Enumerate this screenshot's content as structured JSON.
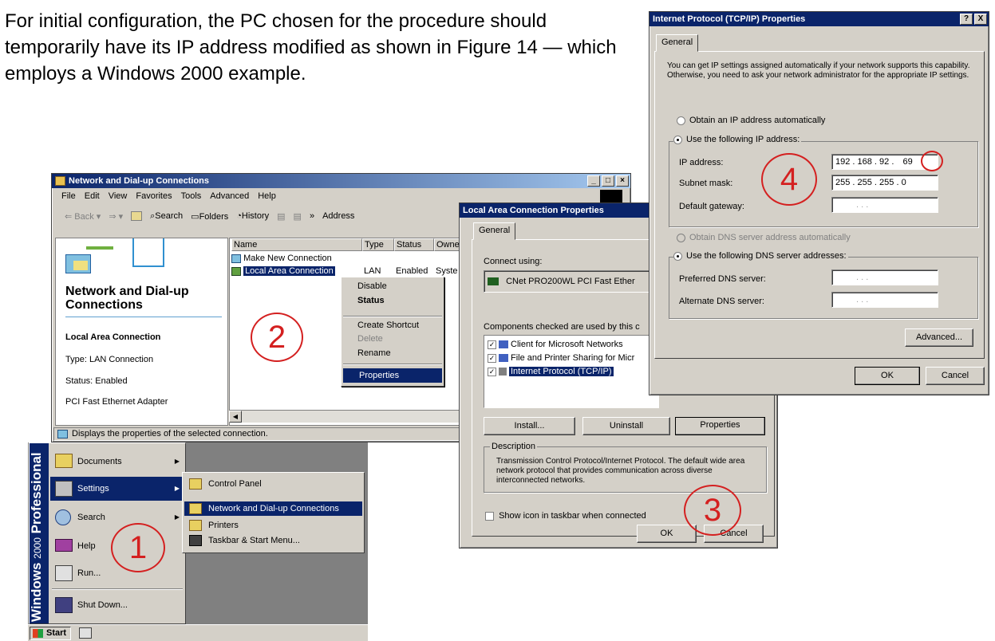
{
  "intro_text": "For initial configuration, the PC chosen for the procedure should temporarily have its IP address modified as shown in Figure 14 — which employs a Windows 2000 example.",
  "ndc": {
    "title": "Network and Dial-up Connections",
    "menu": [
      "File",
      "Edit",
      "View",
      "Favorites",
      "Tools",
      "Advanced",
      "Help"
    ],
    "toolbar": {
      "back": "Back",
      "search": "Search",
      "folders": "Folders",
      "history": "History",
      "address": "Address"
    },
    "heading": "Network and Dial-up Connections",
    "sidebar": {
      "name": "Local Area Connection",
      "type": "Type: LAN Connection",
      "status": "Status: Enabled",
      "adapter": "PCI Fast Ethernet Adapter"
    },
    "columns": [
      "Name",
      "Type",
      "Status",
      "Owne"
    ],
    "rows": [
      {
        "name": "Make New Connection",
        "type": "",
        "status": "",
        "owner": ""
      },
      {
        "name": "Local Area Connection",
        "type": "LAN",
        "status": "Enabled",
        "owner": "Syste"
      }
    ],
    "context_menu": [
      "Disable",
      "Status",
      "Create Shortcut",
      "Delete",
      "Rename",
      "Properties"
    ],
    "statusbar": "Displays the properties of the selected connection."
  },
  "start_menu": {
    "banner_bold": "Windows",
    "banner_num": "2000",
    "banner_ed": "Professional",
    "items": [
      "Documents",
      "Settings",
      "Search",
      "Help",
      "Run...",
      "Shut Down..."
    ],
    "submenu": [
      "Control Panel",
      "Network and Dial-up Connections",
      "Printers",
      "Taskbar & Start Menu..."
    ],
    "start_label": "Start"
  },
  "lac": {
    "title": "Local Area Connection Properties",
    "tab": "General",
    "connect_using": "Connect using:",
    "adapter": "CNet PRO200WL PCI Fast Ether",
    "components_label": "Components checked are used by this c",
    "components": [
      "Client for Microsoft Networks",
      "File and Printer Sharing for Micr",
      "Internet Protocol (TCP/IP)"
    ],
    "install": "Install...",
    "uninstall": "Uninstall",
    "properties": "Properties",
    "description_label": "Description",
    "description": "Transmission Control Protocol/Internet Protocol. The default wide area network protocol that provides communication across diverse interconnected networks.",
    "show_icon": "Show icon in taskbar when connected",
    "ok": "OK",
    "cancel": "Cancel"
  },
  "tcp": {
    "title": "Internet Protocol (TCP/IP) Properties",
    "help_btn": "?",
    "close_btn": "X",
    "tab": "General",
    "intro": "You can get IP settings assigned automatically if your network supports this capability. Otherwise, you need to ask your network administrator for the appropriate IP settings.",
    "obtain_ip": "Obtain an IP address automatically",
    "use_ip": "Use the following IP address:",
    "ip_label": "IP address:",
    "ip_value": "192 . 168 . 92",
    "ip_last": "69",
    "mask_label": "Subnet mask:",
    "mask_value": "255 . 255 . 255 .   0",
    "gw_label": "Default gateway:",
    "gw_value": ".        .        .",
    "obtain_dns": "Obtain DNS server address automatically",
    "use_dns": "Use the following DNS server addresses:",
    "pref_label": "Preferred DNS server:",
    "pref_value": ".        .        .",
    "alt_label": "Alternate DNS server:",
    "alt_value": ".        .        .",
    "advanced": "Advanced...",
    "ok": "OK",
    "cancel": "Cancel"
  },
  "callouts": [
    "1",
    "2",
    "3",
    "4"
  ]
}
